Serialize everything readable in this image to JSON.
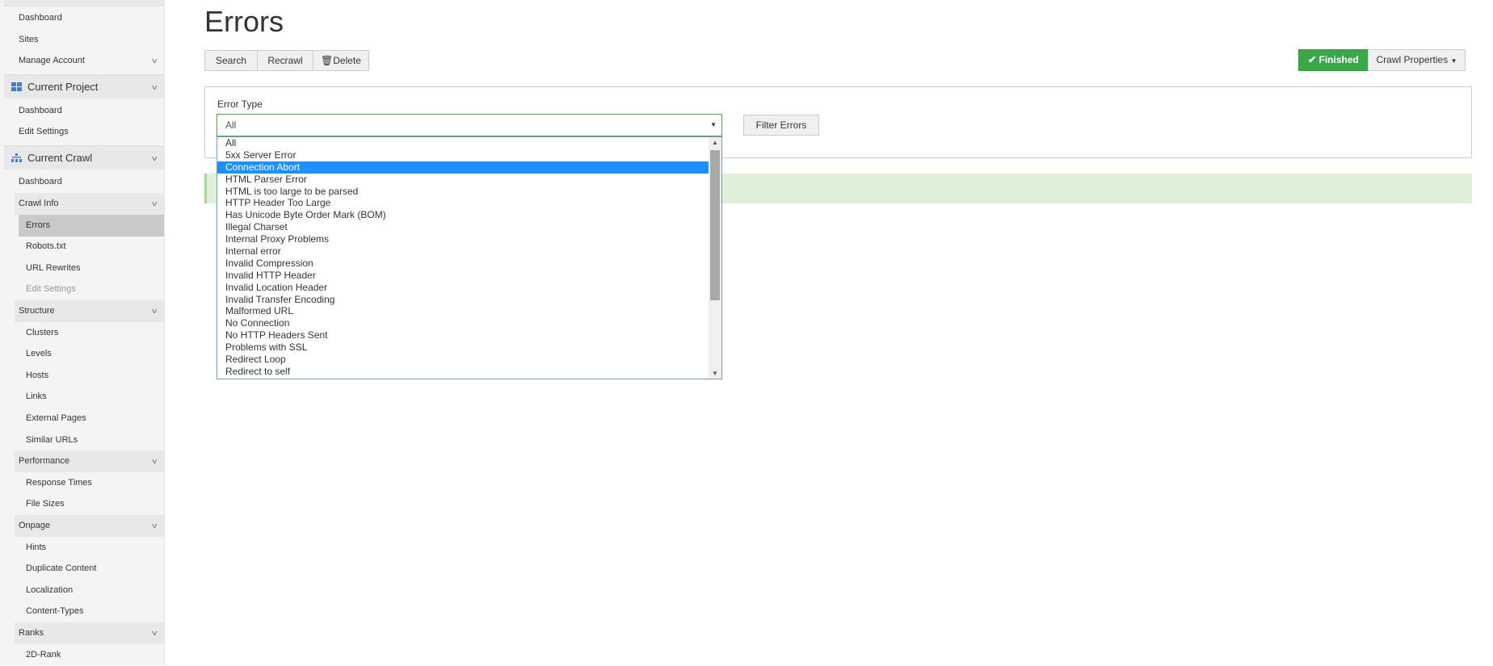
{
  "sidebar": {
    "account": [
      {
        "label": "Dashboard"
      },
      {
        "label": "Sites"
      },
      {
        "label": "Manage Account"
      }
    ],
    "current_project": {
      "title": "Current Project",
      "items": [
        {
          "label": "Dashboard"
        },
        {
          "label": "Edit Settings"
        }
      ]
    },
    "current_crawl": {
      "title": "Current Crawl",
      "dashboard": "Dashboard",
      "groups": [
        {
          "label": "Crawl Info",
          "items": [
            "Errors",
            "Robots.txt",
            "URL Rewrites",
            "Edit Settings"
          ]
        },
        {
          "label": "Structure",
          "items": [
            "Clusters",
            "Levels",
            "Hosts",
            "Links",
            "External Pages",
            "Similar URLs"
          ]
        },
        {
          "label": "Performance",
          "items": [
            "Response Times",
            "File Sizes"
          ]
        },
        {
          "label": "Onpage",
          "items": [
            "Hints",
            "Duplicate Content",
            "Localization",
            "Content-Types"
          ]
        },
        {
          "label": "Ranks",
          "items": [
            "2D-Rank"
          ]
        }
      ],
      "active": "Errors",
      "disabled": "Edit Settings"
    }
  },
  "page": {
    "title": "Errors"
  },
  "toolbar": {
    "search": "Search",
    "recrawl": "Recrawl",
    "delete": "Delete",
    "status": "Finished",
    "crawl_properties": "Crawl Properties"
  },
  "filter": {
    "label": "Error Type",
    "selected": "All",
    "button": "Filter Errors",
    "options": [
      "All",
      "5xx Server Error",
      "Connection Abort",
      "HTML Parser Error",
      "HTML is too large to be parsed",
      "HTTP Header Too Large",
      "Has Unicode Byte Order Mark (BOM)",
      "Illegal Charset",
      "Internal Proxy Problems",
      "Internal error",
      "Invalid Compression",
      "Invalid HTTP Header",
      "Invalid Location Header",
      "Invalid Transfer Encoding",
      "Malformed URL",
      "No Connection",
      "No HTTP Headers Sent",
      "Problems with SSL",
      "Redirect Loop",
      "Redirect to self"
    ],
    "highlighted": "Connection Abort"
  },
  "colors": {
    "success": "#3aa84a",
    "highlight": "#1e90ff",
    "alert": "#dff0d8"
  }
}
